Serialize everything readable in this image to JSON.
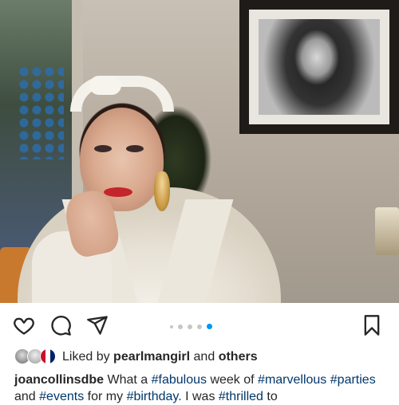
{
  "post": {
    "image_alt": "",
    "carousel": {
      "count": 5,
      "active_index": 4
    }
  },
  "actions": {
    "like_icon": "heart-icon",
    "comment_icon": "comment-icon",
    "share_icon": "send-icon",
    "save_icon": "bookmark-icon"
  },
  "likes": {
    "prefix": "Liked by",
    "user": "pearlmangirl",
    "and": "and",
    "others": "others"
  },
  "caption": {
    "username": "joancollinsdbe",
    "t1": "What a",
    "h1": "#fabulous",
    "t2": "week of",
    "h2": "#marvellous",
    "h3": "#parties",
    "t3": "and",
    "h4": "#events",
    "t4": "for my",
    "h5": "#birthday",
    "t5": ". I was",
    "h6": "#thrilled",
    "t6": "to"
  },
  "colors": {
    "accent": "#0095f6",
    "hashtag": "#00376b",
    "text": "#262626"
  }
}
